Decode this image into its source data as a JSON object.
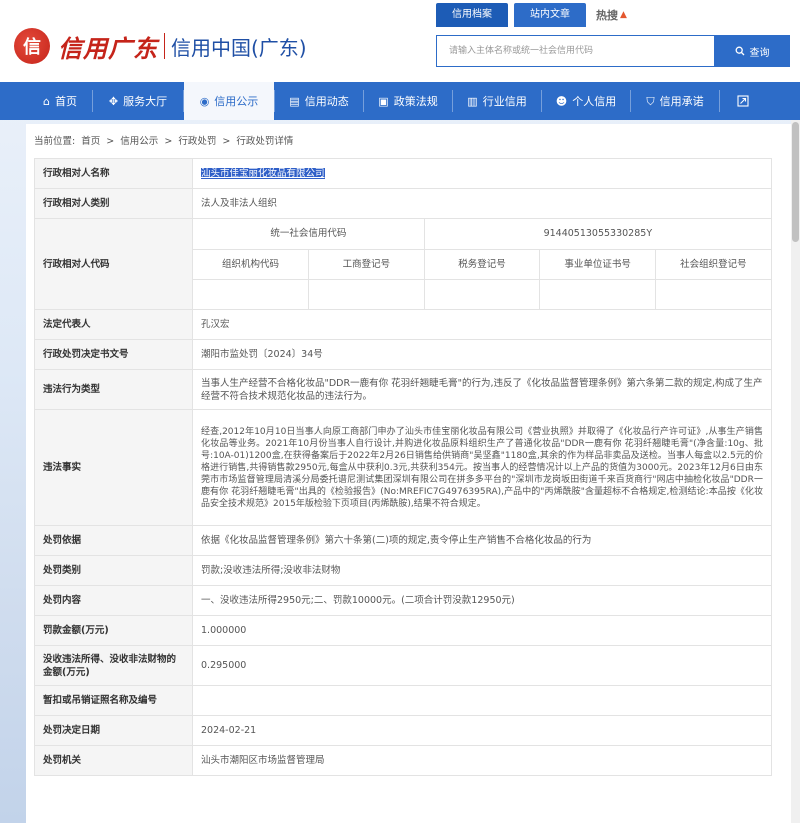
{
  "header": {
    "logo_mark": "信",
    "logo_script": "信用广东",
    "logo_text": "信用中国(广东)",
    "top_tabs": [
      "信用档案",
      "站内文章"
    ],
    "hot_label": "热搜",
    "search_placeholder": "请输入主体名称或统一社会信用代码",
    "search_button": "查询"
  },
  "nav": {
    "items": [
      {
        "label": "首页",
        "icon": "home-icon"
      },
      {
        "label": "服务大厅",
        "icon": "grid-icon"
      },
      {
        "label": "信用公示",
        "icon": "megaphone-icon"
      },
      {
        "label": "信用动态",
        "icon": "news-icon"
      },
      {
        "label": "政策法规",
        "icon": "book-icon"
      },
      {
        "label": "行业信用",
        "icon": "building-icon"
      },
      {
        "label": "个人信用",
        "icon": "person-icon"
      },
      {
        "label": "信用承诺",
        "icon": "shield-icon"
      }
    ],
    "active_index": 2
  },
  "breadcrumb": {
    "prefix": "当前位置:",
    "items": [
      "首页",
      "信用公示",
      "行政处罚",
      "行政处罚详情"
    ],
    "separator": ">"
  },
  "detail": {
    "name_label": "行政相对人名称",
    "name_value": "汕头市佳宝丽化妆品有限公司",
    "category_label": "行政相对人类别",
    "category_value": "法人及非法人组织",
    "code_label": "行政相对人代码",
    "uscc_label": "统一社会信用代码",
    "uscc_value": "91440513055330285Y",
    "code_headers": [
      "组织机构代码",
      "工商登记号",
      "税务登记号",
      "事业单位证书号",
      "社会组织登记号"
    ],
    "legal_rep_label": "法定代表人",
    "legal_rep_value": "孔汉宏",
    "doc_no_label": "行政处罚决定书文号",
    "doc_no_value": "潮阳市监处罚〔2024〕34号",
    "violation_type_label": "违法行为类型",
    "violation_type_value": "当事人生产经营不合格化妆品\"DDR一鹿有你 花羽纤翘睫毛膏\"的行为,违反了《化妆品监督管理条例》第六条第二款的规定,构成了生产经营不符合技术规范化妆品的违法行为。",
    "facts_label": "违法事实",
    "facts_value": "经查,2012年10月10日当事人向原工商部门申办了汕头市佳宝丽化妆品有限公司《营业执照》并取得了《化妆品行产许可证》,从事生产销售化妆品等业务。2021年10月份当事人自行设计,并购进化妆品原料组织生产了普通化妆品\"DDR一鹿有你 花羽纤翘睫毛膏\"(净含量:10g、批号:10A-01)1200盒,在获得备案后于2022年2月26日销售给供销商\"吴坚鑫\"1180盒,其余的作为样品非卖品及送检。当事人每盒以2.5元的价格进行销售,共得销售款2950元,每盒从中获利0.3元,共获利354元。按当事人的经营情况计以上产品的货值为3000元。2023年12月6日由东莞市市场监督管理局清溪分局委托谱尼测试集团深圳有限公司在拼多多平台的\"深圳市龙岗坂田街道千来百货商行\"网店中抽检化妆品\"DDR一鹿有你 花羽纤翘睫毛膏\"出具的《检验报告》(No:MREFIC7G4976395RA),产品中的\"丙烯酰胺\"含量超标不合格规定,检测结论:本品按《化妆品安全技术规范》2015年版检验下页项目(丙烯酰胺),结果不符合规定。",
    "basis_label": "处罚依据",
    "basis_value": "依据《化妆品监督管理条例》第六十条第(二)项的规定,责令停止生产销售不合格化妆品的行为",
    "penalty_type_label": "处罚类别",
    "penalty_type_value": "罚款;没收违法所得;没收非法财物",
    "penalty_content_label": "处罚内容",
    "penalty_content_value": "一、没收违法所得2950元;二、罚款10000元。(二项合计罚没款12950元)",
    "fine_label": "罚款金额(万元)",
    "fine_value": "1.000000",
    "confiscation_label": "没收违法所得、没收非法财物的金额(万元)",
    "confiscation_value": "0.295000",
    "license_label": "暂扣或吊销证照名称及编号",
    "license_value": "",
    "date_label": "处罚决定日期",
    "date_value": "2024-02-21",
    "authority_label": "处罚机关",
    "authority_value": "汕头市潮阳区市场监督管理局"
  },
  "colors": {
    "primary": "#2d6cc8",
    "brand_red": "#c5241a",
    "label_bg": "#f5f5f5",
    "border": "#e3e3e3"
  }
}
